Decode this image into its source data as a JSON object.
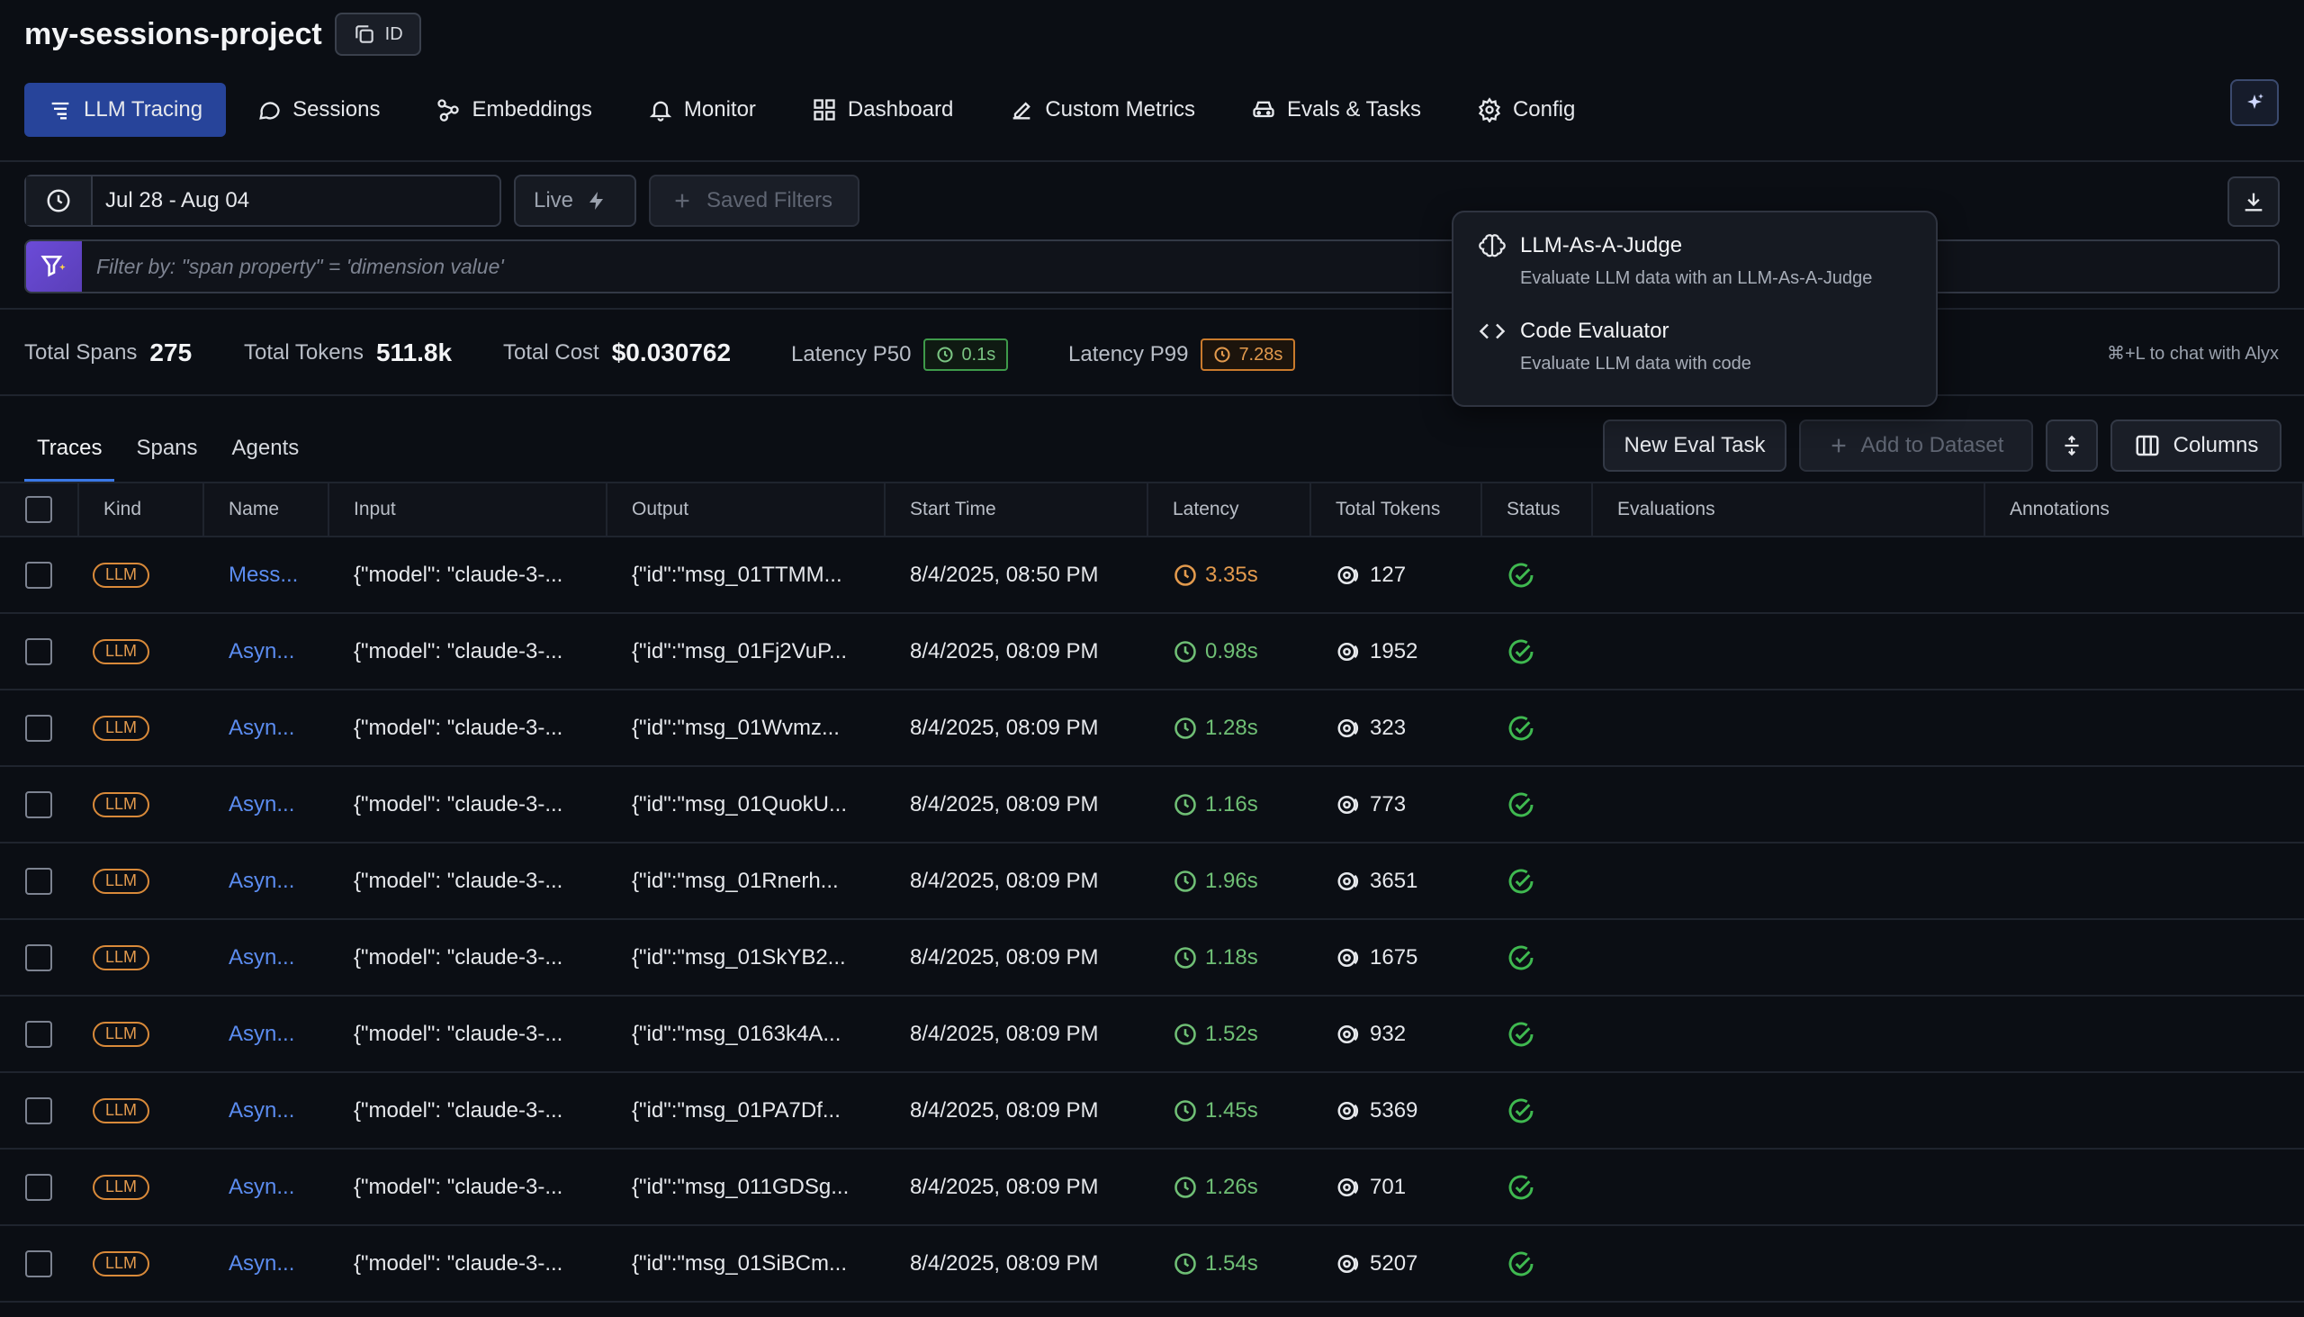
{
  "header": {
    "project_name": "my-sessions-project",
    "id_button": "ID",
    "nav": [
      {
        "label": "LLM Tracing",
        "icon": "tracing-icon"
      },
      {
        "label": "Sessions",
        "icon": "chat-bubble-icon"
      },
      {
        "label": "Embeddings",
        "icon": "embeddings-icon"
      },
      {
        "label": "Monitor",
        "icon": "bell-icon"
      },
      {
        "label": "Dashboard",
        "icon": "grid-icon"
      },
      {
        "label": "Custom Metrics",
        "icon": "pencil-icon"
      },
      {
        "label": "Evals & Tasks",
        "icon": "car-icon"
      },
      {
        "label": "Config",
        "icon": "gear-icon"
      }
    ]
  },
  "filters": {
    "date_range": "Jul 28 - Aug 04",
    "live_label": "Live",
    "saved_filters_label": "Saved Filters",
    "filter_placeholder": "Filter by: \"span property\" = 'dimension value'"
  },
  "stats": {
    "total_spans_label": "Total Spans",
    "total_spans": "275",
    "total_tokens_label": "Total Tokens",
    "total_tokens": "511.8k",
    "total_cost_label": "Total Cost",
    "total_cost": "$0.030762",
    "p50_label": "Latency P50",
    "p50": "0.1s",
    "p99_label": "Latency P99",
    "p99": "7.28s",
    "alyx_hint": "⌘+L to chat with Alyx"
  },
  "tabs": [
    "Traces",
    "Spans",
    "Agents"
  ],
  "actions": {
    "new_eval": "New Eval Task",
    "add_dataset": "Add to Dataset",
    "columns": "Columns"
  },
  "dropdown": {
    "items": [
      {
        "title": "LLM-As-A-Judge",
        "desc": "Evaluate LLM data with an LLM-As-A-Judge"
      },
      {
        "title": "Code Evaluator",
        "desc": "Evaluate LLM data with code"
      }
    ]
  },
  "table": {
    "columns": [
      "Kind",
      "Name",
      "Input",
      "Output",
      "Start Time",
      "Latency",
      "Total Tokens",
      "Status",
      "Evaluations",
      "Annotations"
    ],
    "rows": [
      {
        "kind": "LLM",
        "name": "Mess...",
        "input": "{\"model\": \"claude-3-...",
        "output": "{\"id\":\"msg_01TTMM...",
        "start": "8/4/2025, 08:50 PM",
        "latency": "3.35s",
        "lat_color": "orange",
        "tokens": "127"
      },
      {
        "kind": "LLM",
        "name": "Asyn...",
        "input": "{\"model\": \"claude-3-...",
        "output": "{\"id\":\"msg_01Fj2VuP...",
        "start": "8/4/2025, 08:09 PM",
        "latency": "0.98s",
        "lat_color": "green",
        "tokens": "1952"
      },
      {
        "kind": "LLM",
        "name": "Asyn...",
        "input": "{\"model\": \"claude-3-...",
        "output": "{\"id\":\"msg_01Wvmz...",
        "start": "8/4/2025, 08:09 PM",
        "latency": "1.28s",
        "lat_color": "green",
        "tokens": "323"
      },
      {
        "kind": "LLM",
        "name": "Asyn...",
        "input": "{\"model\": \"claude-3-...",
        "output": "{\"id\":\"msg_01QuokU...",
        "start": "8/4/2025, 08:09 PM",
        "latency": "1.16s",
        "lat_color": "green",
        "tokens": "773"
      },
      {
        "kind": "LLM",
        "name": "Asyn...",
        "input": "{\"model\": \"claude-3-...",
        "output": "{\"id\":\"msg_01Rnerh...",
        "start": "8/4/2025, 08:09 PM",
        "latency": "1.96s",
        "lat_color": "green",
        "tokens": "3651"
      },
      {
        "kind": "LLM",
        "name": "Asyn...",
        "input": "{\"model\": \"claude-3-...",
        "output": "{\"id\":\"msg_01SkYB2...",
        "start": "8/4/2025, 08:09 PM",
        "latency": "1.18s",
        "lat_color": "green",
        "tokens": "1675"
      },
      {
        "kind": "LLM",
        "name": "Asyn...",
        "input": "{\"model\": \"claude-3-...",
        "output": "{\"id\":\"msg_0163k4A...",
        "start": "8/4/2025, 08:09 PM",
        "latency": "1.52s",
        "lat_color": "green",
        "tokens": "932"
      },
      {
        "kind": "LLM",
        "name": "Asyn...",
        "input": "{\"model\": \"claude-3-...",
        "output": "{\"id\":\"msg_01PA7Df...",
        "start": "8/4/2025, 08:09 PM",
        "latency": "1.45s",
        "lat_color": "green",
        "tokens": "5369"
      },
      {
        "kind": "LLM",
        "name": "Asyn...",
        "input": "{\"model\": \"claude-3-...",
        "output": "{\"id\":\"msg_011GDSg...",
        "start": "8/4/2025, 08:09 PM",
        "latency": "1.26s",
        "lat_color": "green",
        "tokens": "701"
      },
      {
        "kind": "LLM",
        "name": "Asyn...",
        "input": "{\"model\": \"claude-3-...",
        "output": "{\"id\":\"msg_01SiBCm...",
        "start": "8/4/2025, 08:09 PM",
        "latency": "1.54s",
        "lat_color": "green",
        "tokens": "5207"
      }
    ]
  },
  "colors": {
    "background": "#0b0e14",
    "accent": "#27449a",
    "link": "#5b8cf0",
    "ok": "#3fb950",
    "warn": "#e39a4d"
  }
}
